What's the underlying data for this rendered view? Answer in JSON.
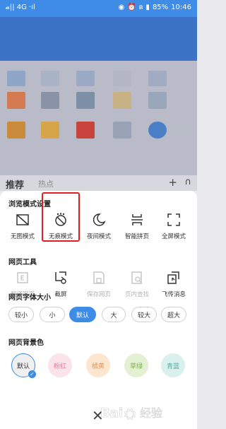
{
  "status_bar": {
    "left": "𝓪|| 4G ·ıl",
    "battery": "85%",
    "time": "10:46"
  },
  "background": {
    "tab_active": "推荐",
    "tab_other": "热点",
    "plus": "+"
  },
  "browse_mode": {
    "title": "浏览模式设置",
    "items": [
      {
        "label": "无图模式",
        "icon": "no-image-icon"
      },
      {
        "label": "无痕模式",
        "icon": "incognito-icon",
        "highlighted": true
      },
      {
        "label": "夜间模式",
        "icon": "moon-icon"
      },
      {
        "label": "智能拼页",
        "icon": "page-join-icon"
      },
      {
        "label": "全屏模式",
        "icon": "fullscreen-icon"
      }
    ]
  },
  "page_tools": {
    "title": "网页工具",
    "items": [
      {
        "label": "翻译网页",
        "icon": "translate-icon",
        "enabled": false
      },
      {
        "label": "截屏",
        "icon": "scissors-icon",
        "enabled": true
      },
      {
        "label": "保存网页",
        "icon": "save-page-icon",
        "enabled": false
      },
      {
        "label": "页内查找",
        "icon": "find-in-page-icon",
        "enabled": false
      },
      {
        "label": "飞传消息",
        "icon": "send-message-icon",
        "enabled": true
      }
    ]
  },
  "font_size": {
    "title": "网页字体大小",
    "options": [
      "较小",
      "小",
      "默认",
      "大",
      "较大",
      "超大"
    ],
    "selected": "默认"
  },
  "page_bg": {
    "title": "网页背景色",
    "options": [
      {
        "label": "默认",
        "color": "#f0f0f0",
        "text_color": "#333333",
        "selected": true
      },
      {
        "label": "粉红",
        "color": "#fbe3ea",
        "text_color": "#e07a94"
      },
      {
        "label": "橘黄",
        "color": "#fde5cf",
        "text_color": "#e39a55"
      },
      {
        "label": "草绿",
        "color": "#e3f1d2",
        "text_color": "#7fb04f"
      },
      {
        "label": "青蓝",
        "color": "#d9f0ec",
        "text_color": "#5aa99d"
      }
    ]
  },
  "colors": {
    "accent": "#3e8ce6",
    "highlight_box": "#e02020"
  },
  "close_icon": "close-icon"
}
